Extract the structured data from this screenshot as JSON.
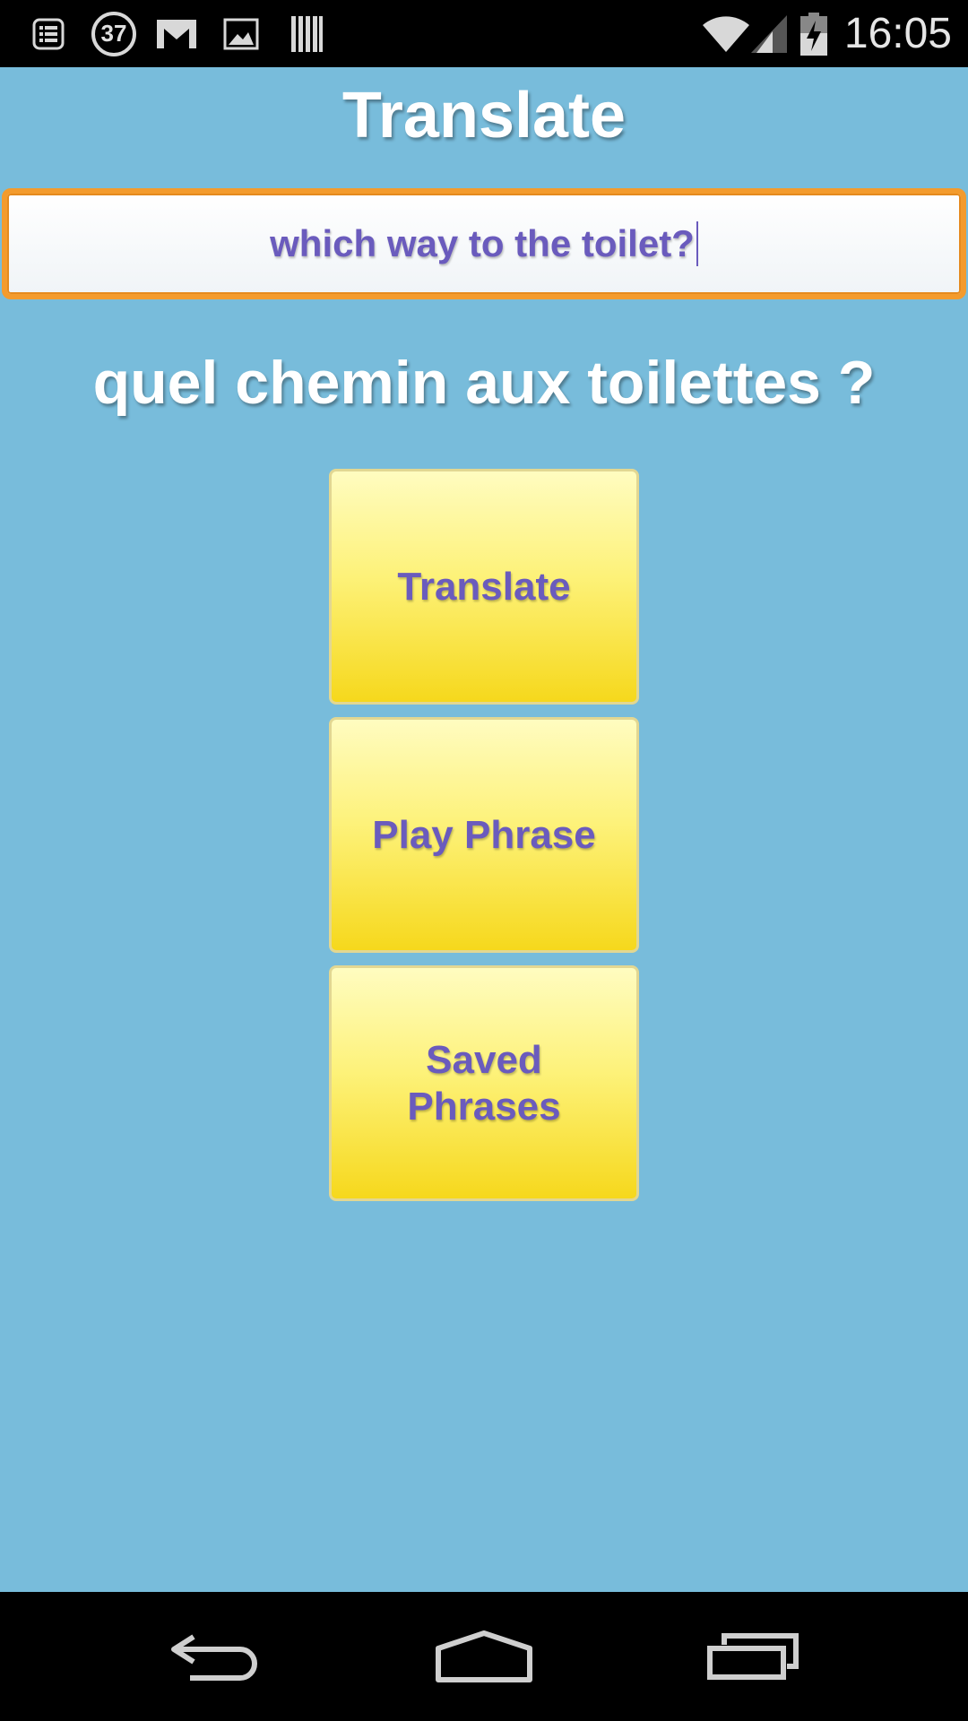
{
  "status_bar": {
    "notification_count": "37",
    "time": "16:05",
    "icons": [
      "task-list-icon",
      "notification-count-icon",
      "gmail-icon",
      "image-icon",
      "barcode-icon",
      "wifi-icon",
      "cell-signal-icon",
      "battery-charging-icon"
    ]
  },
  "app": {
    "title": "Translate",
    "input_value": "which way to the toilet?",
    "translation": "quel chemin aux toilettes ?",
    "buttons": {
      "translate": "Translate",
      "play": "Play Phrase",
      "saved": "Saved Phrases"
    }
  },
  "nav_bar": {
    "icons": [
      "back-icon",
      "home-icon",
      "recent-apps-icon"
    ]
  },
  "colors": {
    "background": "#78bcdb",
    "accent_border": "#f39b2d",
    "text_purple": "#6a5bbd",
    "button_yellow": "#f6d81c"
  }
}
